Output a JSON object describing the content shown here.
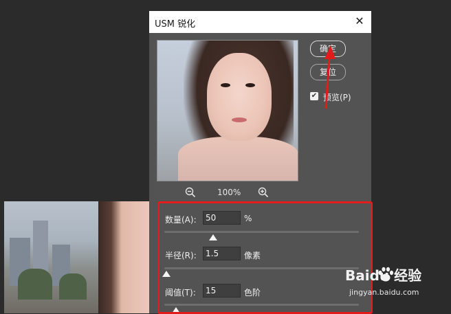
{
  "dialog": {
    "title": "USM 锐化",
    "close_glyph": "✕",
    "ok_label": "确定",
    "reset_label": "复位",
    "preview_label": "预览(P)",
    "preview_checked": true,
    "zoom_level": "100%"
  },
  "params": {
    "amount": {
      "label": "数量(A):",
      "value": "50",
      "unit": "%",
      "slider_fraction": 0.25
    },
    "radius": {
      "label": "半径(R):",
      "value": "1.5",
      "unit": "像素",
      "slider_fraction": 0.01
    },
    "threshold": {
      "label": "阈值(T):",
      "value": "15",
      "unit": "色阶",
      "slider_fraction": 0.06
    }
  },
  "annotations": {
    "highlight_color": "#e21b1b",
    "arrow_color": "#e21b1b"
  },
  "watermark": {
    "logo": "Baidu 经验",
    "url": "jingyan.baidu.com"
  },
  "icons": [
    "zoom-out-icon",
    "zoom-in-icon",
    "close-icon",
    "checkbox-check-icon",
    "baidu-paw-icon"
  ]
}
